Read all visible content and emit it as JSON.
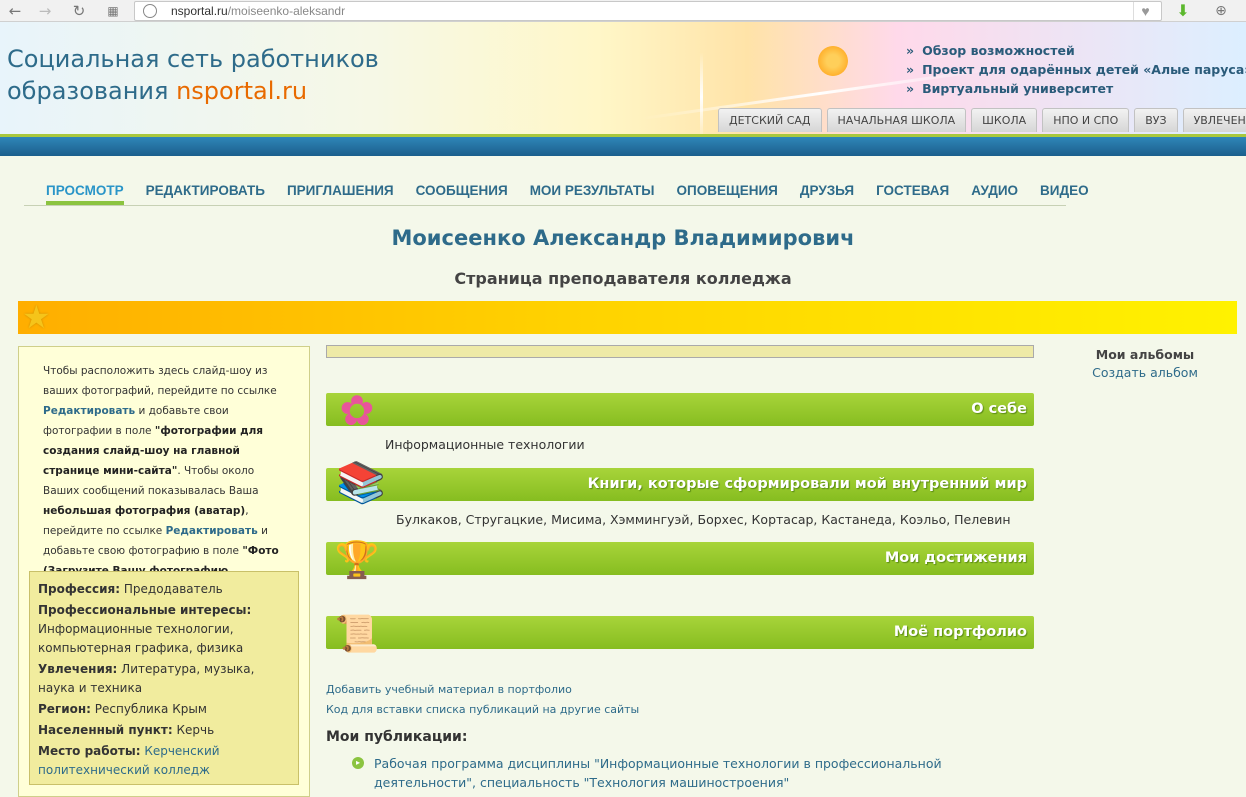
{
  "browser": {
    "url_host": "nsportal.ru",
    "url_path": "/moiseenko-aleksandr"
  },
  "header": {
    "title_line1": "Социальная сеть работников",
    "title_line2_prefix": "образования ",
    "title_brand": "nsportal.ru",
    "links": [
      "Обзор возможностей",
      "Проект для одарённых детей «Алые паруса»",
      "Виртуальный университет"
    ],
    "tabs": [
      "ДЕТСКИЙ САД",
      "НАЧАЛЬНАЯ ШКОЛА",
      "ШКОЛА",
      "НПО И СПО",
      "ВУЗ",
      "УВЛЕЧЕНИЯ"
    ]
  },
  "menu": {
    "items": [
      "ПРОСМОТР",
      "РЕДАКТИРОВАТЬ",
      "ПРИГЛАШЕНИЯ",
      "СООБЩЕНИЯ",
      "МОИ РЕЗУЛЬТАТЫ",
      "ОПОВЕЩЕНИЯ",
      "ДРУЗЬЯ",
      "ГОСТЕВАЯ",
      "АУДИО",
      "ВИДЕО"
    ],
    "active": "ПРОСМОТР"
  },
  "profile": {
    "name": "Моисеенко Александр Владимирович",
    "subtitle": "Страница преподавателя колледжа"
  },
  "left": {
    "t1": "Чтобы расположить здесь слайд-шоу из ваших фотографий, перейдите по ссылке ",
    "link1": "Редактировать",
    "t2": " и добавьте свои фотографии в поле ",
    "b1": "\"фотографии для создания слайд-шоу на главной странице мини-сайта\"",
    "t3": ". Чтобы около Ваших сообщений показывалась Ваша ",
    "b2": "небольшая фотография (аватар)",
    "t4": ", перейдите по ссылке ",
    "link2": "Редактировать",
    "t5": " и добавьте свою фотографию в поле ",
    "b3": "\"Фото (Загрузите Вашу фотографию (аватар))\"",
    "info": {
      "profession_label": "Профессия:",
      "profession": " Предодаватель",
      "interests_label": "Профессиональные интересы:",
      "interests": " Информационные технологии, компьютерная графика, физика",
      "hobbies_label": "Увлечения:",
      "hobbies": " Литература, музыка, наука и техника",
      "region_label": "Регион:",
      "region": " Республика Крым",
      "city_label": "Населенный пункт:",
      "city": " Керчь",
      "work_label": "Место работы:",
      "work": " Керченский политехнический колледж"
    }
  },
  "sections": {
    "about_title": "О себе",
    "about_text": "Информационные технологии",
    "books_title": "Книги, которые сформировали мой внутренний мир",
    "books_text": "Булкаков, Стругацкие, Мисима, Хэммингуэй, Борхес, Кортасар, Кастанеда, Коэльо, Пелевин",
    "achievements_title": "Мои достижения",
    "portfolio_title": "Моё портфолио",
    "add_material": "Добавить учебный материал в портфолио",
    "embed_code": "Код для вставки списка публикаций на другие сайты",
    "publications_title": "Мои публикации:",
    "publications": [
      "Рабочая программа дисциплины \"Информационные технологии в профессиональной деятельности\", специальность \"Технология машиностроения\""
    ]
  },
  "albums": {
    "title": "Мои альбомы",
    "create": "Создать альбом"
  },
  "icons": {
    "about": "flower-icon",
    "books": "books-icon",
    "achievements": "trophy-icon",
    "portfolio": "scroll-icon"
  },
  "colors": {
    "accent_green": "#8bc440",
    "link_blue": "#2e6b8a",
    "brand_orange": "#e86a00"
  }
}
